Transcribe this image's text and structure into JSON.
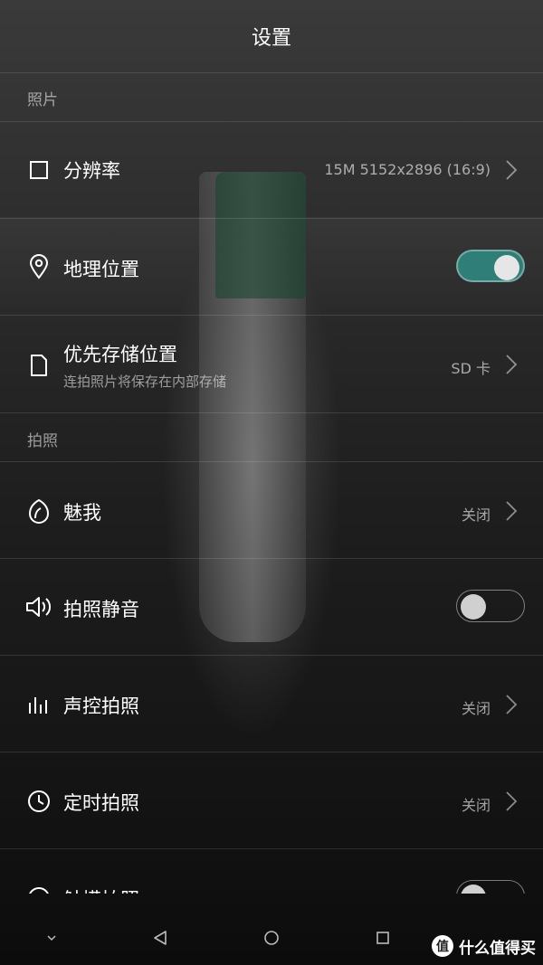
{
  "header": {
    "title": "设置"
  },
  "sections": {
    "photo": "照片",
    "shooting": "拍照"
  },
  "rows": {
    "resolution": {
      "label": "分辨率",
      "value": "15M 5152x2896 (16:9)",
      "icon": "square-icon"
    },
    "location": {
      "label": "地理位置",
      "toggle": "on",
      "icon": "location-pin-icon"
    },
    "storage": {
      "label": "优先存储位置",
      "sub": "连拍照片将保存在内部存储",
      "value": "SD 卡",
      "icon": "document-icon"
    },
    "beauty": {
      "label": "魅我",
      "value": "关闭",
      "icon": "face-icon"
    },
    "mute": {
      "label": "拍照静音",
      "toggle": "off",
      "icon": "speaker-icon"
    },
    "voice": {
      "label": "声控拍照",
      "value": "关闭",
      "icon": "sound-bars-icon"
    },
    "timer": {
      "label": "定时拍照",
      "value": "关闭",
      "icon": "clock-icon"
    },
    "touch": {
      "label": "触摸拍照",
      "toggle": "off",
      "icon": "touch-icon"
    }
  },
  "navbar": {
    "icons": [
      "down-chevron-icon",
      "back-triangle-icon",
      "home-circle-icon",
      "recents-square-icon"
    ]
  },
  "watermark": {
    "text": "什么值得买",
    "badge": "值"
  },
  "colors": {
    "toggle_on": "#2f7f78",
    "background": "#1e1e1e"
  }
}
